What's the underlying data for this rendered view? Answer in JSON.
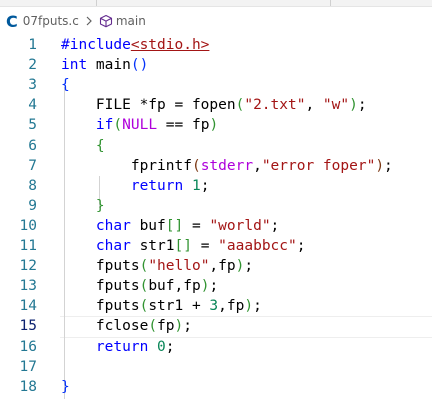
{
  "tabs": [
    "",
    ""
  ],
  "breadcrumb": {
    "lang_icon": "C",
    "file": "07fputs.c",
    "separator_icon": "chevron-right-icon",
    "symbol_icon": "cube-icon",
    "symbol": "main"
  },
  "editor": {
    "active_line": 15,
    "lines": [
      {
        "n": "1",
        "tokens": [
          {
            "t": "#include",
            "c": "pp"
          },
          {
            "t": "<stdio.h>",
            "c": "inc"
          }
        ]
      },
      {
        "n": "2",
        "tokens": [
          {
            "t": "int",
            "c": "kw"
          },
          {
            "t": " main",
            "c": "fn"
          },
          {
            "t": "()",
            "c": "br1"
          }
        ]
      },
      {
        "n": "3",
        "tokens": [
          {
            "t": "{",
            "c": "br1"
          }
        ]
      },
      {
        "n": "4",
        "tokens": [
          {
            "t": "    FILE *fp = fopen",
            "c": "var"
          },
          {
            "t": "(",
            "c": "br2"
          },
          {
            "t": "\"2.txt\"",
            "c": "str"
          },
          {
            "t": ", ",
            "c": "var"
          },
          {
            "t": "\"w\"",
            "c": "str"
          },
          {
            "t": ")",
            "c": "br2"
          },
          {
            "t": ";",
            "c": "var"
          }
        ]
      },
      {
        "n": "5",
        "tokens": [
          {
            "t": "    if",
            "c": "kw"
          },
          {
            "t": "(",
            "c": "br2"
          },
          {
            "t": "NULL",
            "c": "mac"
          },
          {
            "t": " == fp",
            "c": "var"
          },
          {
            "t": ")",
            "c": "br2"
          }
        ]
      },
      {
        "n": "6",
        "tokens": [
          {
            "t": "    {",
            "c": "br2"
          }
        ]
      },
      {
        "n": "7",
        "tokens": [
          {
            "t": "        fprintf",
            "c": "var"
          },
          {
            "t": "(",
            "c": "br3"
          },
          {
            "t": "stderr",
            "c": "mac"
          },
          {
            "t": ",",
            "c": "var"
          },
          {
            "t": "\"error foper\"",
            "c": "str"
          },
          {
            "t": ")",
            "c": "br3"
          },
          {
            "t": ";",
            "c": "var"
          }
        ]
      },
      {
        "n": "8",
        "tokens": [
          {
            "t": "        return",
            "c": "kw"
          },
          {
            "t": " ",
            "c": "var"
          },
          {
            "t": "1",
            "c": "num"
          },
          {
            "t": ";",
            "c": "var"
          }
        ]
      },
      {
        "n": "9",
        "tokens": [
          {
            "t": "    }",
            "c": "br2"
          }
        ]
      },
      {
        "n": "10",
        "tokens": [
          {
            "t": "    char",
            "c": "kw"
          },
          {
            "t": " buf",
            "c": "var"
          },
          {
            "t": "[]",
            "c": "br2"
          },
          {
            "t": " = ",
            "c": "var"
          },
          {
            "t": "\"world\"",
            "c": "str"
          },
          {
            "t": ";",
            "c": "var"
          }
        ]
      },
      {
        "n": "11",
        "tokens": [
          {
            "t": "    char",
            "c": "kw"
          },
          {
            "t": " str1",
            "c": "var"
          },
          {
            "t": "[]",
            "c": "br2"
          },
          {
            "t": " = ",
            "c": "var"
          },
          {
            "t": "\"aaabbcc\"",
            "c": "str"
          },
          {
            "t": ";",
            "c": "var"
          }
        ]
      },
      {
        "n": "12",
        "tokens": [
          {
            "t": "    fputs",
            "c": "var"
          },
          {
            "t": "(",
            "c": "br2"
          },
          {
            "t": "\"hello\"",
            "c": "str"
          },
          {
            "t": ",fp",
            "c": "var"
          },
          {
            "t": ")",
            "c": "br2"
          },
          {
            "t": ";",
            "c": "var"
          }
        ]
      },
      {
        "n": "13",
        "tokens": [
          {
            "t": "    fputs",
            "c": "var"
          },
          {
            "t": "(",
            "c": "br2"
          },
          {
            "t": "buf,fp",
            "c": "var"
          },
          {
            "t": ")",
            "c": "br2"
          },
          {
            "t": ";",
            "c": "var"
          }
        ]
      },
      {
        "n": "14",
        "tokens": [
          {
            "t": "    fputs",
            "c": "var"
          },
          {
            "t": "(",
            "c": "br2"
          },
          {
            "t": "str1 + ",
            "c": "var"
          },
          {
            "t": "3",
            "c": "num"
          },
          {
            "t": ",fp",
            "c": "var"
          },
          {
            "t": ")",
            "c": "br2"
          },
          {
            "t": ";",
            "c": "var"
          }
        ]
      },
      {
        "n": "15",
        "tokens": [
          {
            "t": "    fclose",
            "c": "var"
          },
          {
            "t": "(",
            "c": "br2"
          },
          {
            "t": "fp",
            "c": "var"
          },
          {
            "t": ")",
            "c": "br2"
          },
          {
            "t": ";",
            "c": "var"
          }
        ]
      },
      {
        "n": "16",
        "tokens": [
          {
            "t": "    return",
            "c": "kw"
          },
          {
            "t": " ",
            "c": "var"
          },
          {
            "t": "0",
            "c": "num"
          },
          {
            "t": ";",
            "c": "var"
          }
        ]
      },
      {
        "n": "17",
        "tokens": []
      },
      {
        "n": "18",
        "tokens": [
          {
            "t": "}",
            "c": "br1"
          }
        ]
      }
    ]
  }
}
